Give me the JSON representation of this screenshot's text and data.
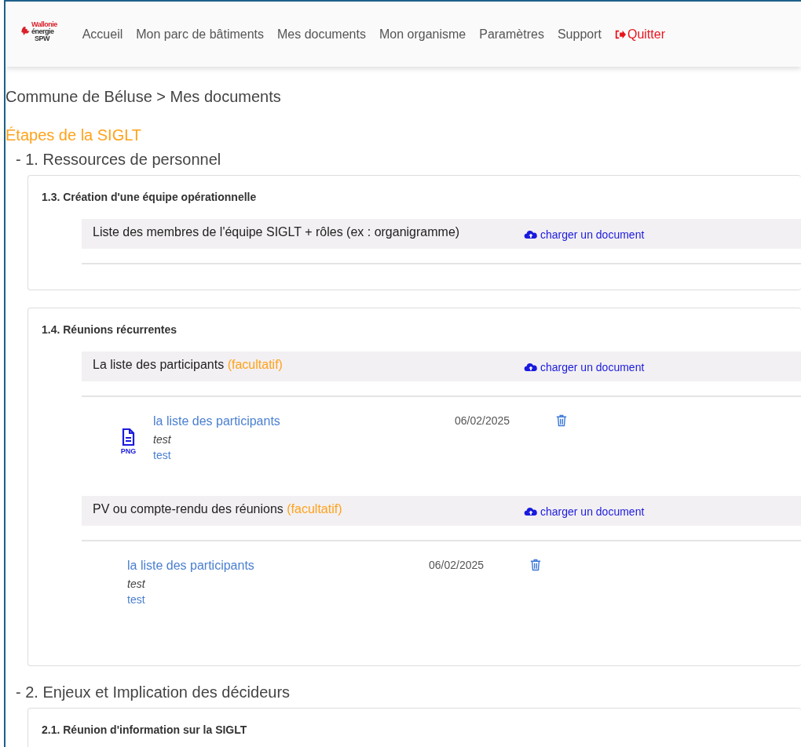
{
  "logo": {
    "lines": [
      "Wallonie",
      "énergie",
      "SPW"
    ]
  },
  "nav": {
    "items": [
      {
        "label": "Accueil",
        "kind": "link"
      },
      {
        "label": "Mon parc de bâtiments",
        "kind": "link"
      },
      {
        "label": "Mes documents",
        "kind": "link"
      },
      {
        "label": "Mon organisme",
        "kind": "link"
      },
      {
        "label": "Paramètres",
        "kind": "link"
      },
      {
        "label": "Support",
        "kind": "link"
      },
      {
        "label": "Quitter",
        "kind": "logout"
      }
    ]
  },
  "breadcrumb": "Commune de Béluse > Mes documents",
  "page_title": "Étapes de la SIGLT",
  "sections": [
    {
      "title": "- 1. Ressources de personnel",
      "cards": [
        {
          "title": "1.3. Création d'une équipe opérationnelle",
          "requirements": [
            {
              "label": "Liste des membres de l'équipe SIGLT + rôles (ex : organigramme)",
              "upload": "charger un document"
            }
          ]
        },
        {
          "title": "1.4. Réunions récurrentes",
          "requirements": [
            {
              "label": "La liste des participants",
              "optional_note": "(facultatif)",
              "upload": "charger un document",
              "documents": [
                {
                  "file_type": "PNG",
                  "title": "la liste des participants",
                  "date": "06/02/2025",
                  "description": "test",
                  "link": "test"
                }
              ]
            },
            {
              "label": "PV ou compte-rendu des réunions",
              "optional_note": "(facultatif)",
              "upload": "charger un document",
              "documents": [
                {
                  "title": "la liste des participants",
                  "date": "06/02/2025",
                  "description": "test",
                  "link": "test"
                }
              ]
            }
          ]
        }
      ]
    },
    {
      "title": "- 2. Enjeux et Implication des décideurs",
      "cards": [
        {
          "title": "2.1. Réunion d'information sur la SIGLT"
        }
      ]
    }
  ]
}
